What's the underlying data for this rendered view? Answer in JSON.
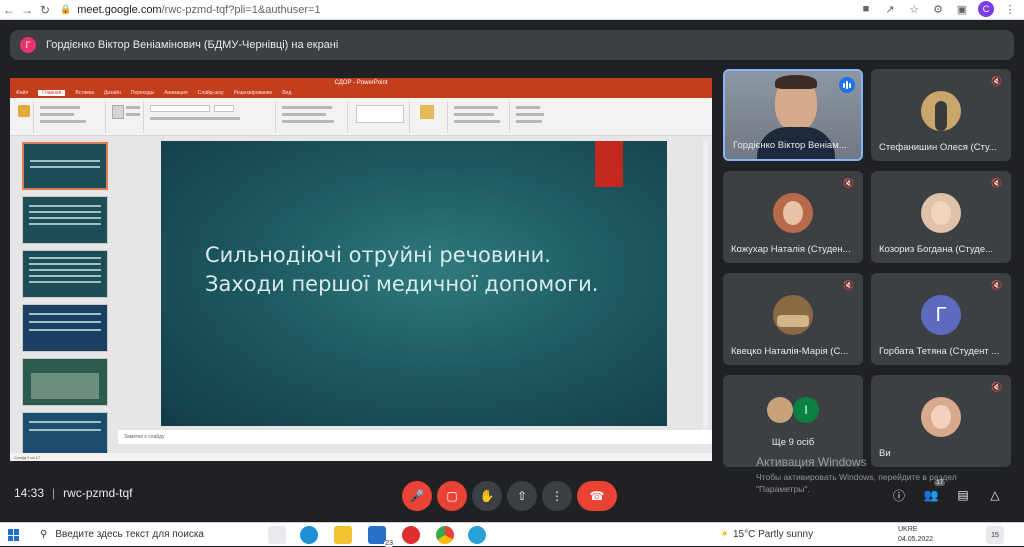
{
  "browser": {
    "url_host": "meet.google.com",
    "url_path": "/rwc-pzmd-tqf?pli=1&authuser=1",
    "profile_initial": "C"
  },
  "presenter": {
    "initial": "Г",
    "text": "Гордієнко Віктор Веніамінович (БДМУ-Чернівці) на екрані"
  },
  "slide": {
    "title_line1": "Сильнодіючі отруйні речовини.",
    "title_line2": "Заходи першої медичної допомоги.",
    "notes_placeholder": "Заметки к слайду"
  },
  "powerpoint": {
    "window_title": "СДОР - PowerPoint",
    "tabs": [
      "Файл",
      "Главная",
      "Вставка",
      "Дизайн",
      "Переходы",
      "Анимация",
      "Слайд-шоу",
      "Рецензирование",
      "Вид"
    ],
    "status": "Слайд 1 из 17"
  },
  "participants": [
    {
      "name": "Гордієнко Віктор Веніам...",
      "type": "video",
      "speaking": true
    },
    {
      "name": "Стефанишин Олеся (Сту...",
      "type": "photo",
      "muted": true,
      "color": "#c9a76b"
    },
    {
      "name": "Кожухар Наталія (Студен...",
      "type": "photo",
      "muted": true,
      "color": "#b86b4b"
    },
    {
      "name": "Козориз Богдана (Студе...",
      "type": "photo",
      "muted": true,
      "color": "#e0c2a8"
    },
    {
      "name": "Квецко Наталія-Марія (С...",
      "type": "photo",
      "muted": true,
      "color": "#8a6a42"
    },
    {
      "name": "Горбата Тетяна (Студент ...",
      "type": "initial",
      "initial": "Г",
      "muted": true,
      "color": "#5c6bc0"
    },
    {
      "name": "Ще 9 осіб",
      "type": "group",
      "initial": "I",
      "color": "#0b8043"
    },
    {
      "name": "Ви",
      "type": "photo",
      "muted": true,
      "color": "#d9a98e"
    }
  ],
  "meeting": {
    "time": "14:33",
    "code": "rwc-pzmd-tqf",
    "people_count": "17"
  },
  "activation": {
    "title": "Активация Windows",
    "subtitle": "Чтобы активировать Windows, перейдите в раздел \"Параметры\"."
  },
  "taskbar": {
    "search_placeholder": "Введите здесь текст для поиска",
    "mail_badge": "23",
    "weather": "15°C  Partly sunny",
    "lang": "UKRE",
    "date": "04.05.2022",
    "notif": "15"
  }
}
